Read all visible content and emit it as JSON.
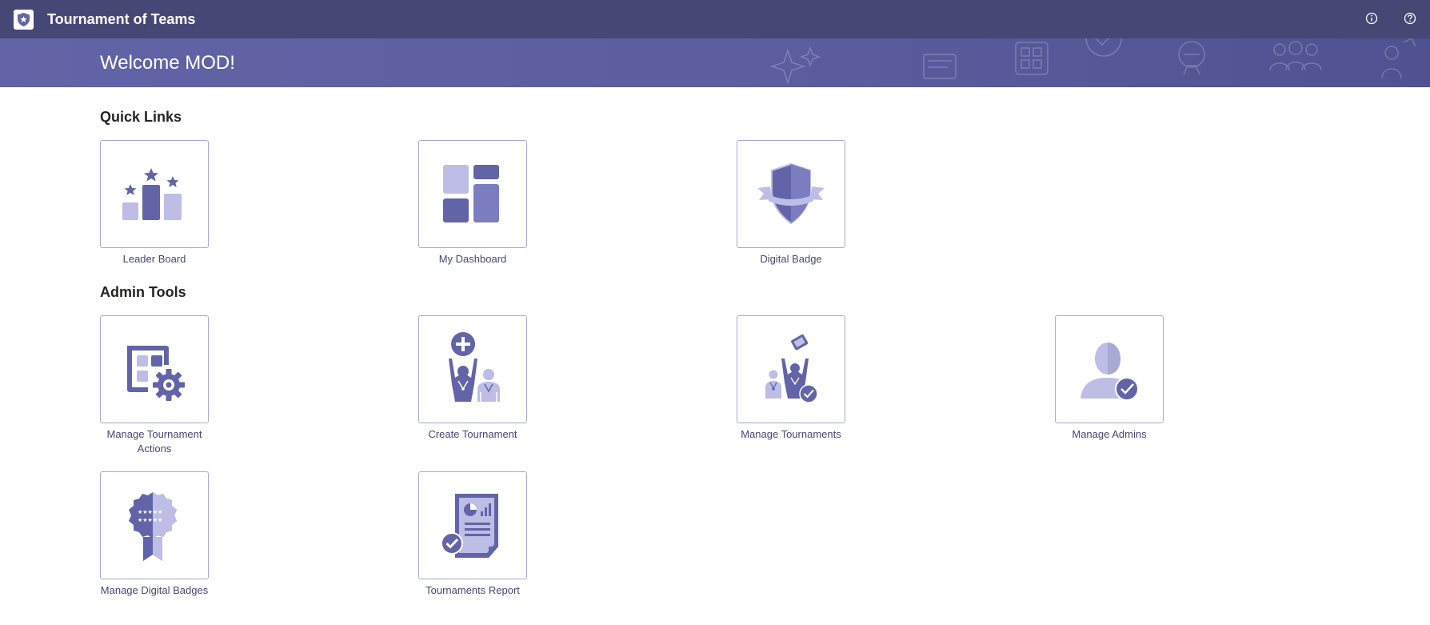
{
  "header": {
    "app_title": "Tournament of Teams",
    "logo_icon": "shield-star-logo",
    "info_icon": "info-circle-icon",
    "help_icon": "help-circle-icon"
  },
  "banner": {
    "welcome": "Welcome MOD!"
  },
  "quick_links": {
    "title": "Quick Links",
    "tiles": [
      {
        "label": "Leader Board",
        "icon": "leaderboard-podium-icon"
      },
      {
        "label": "My Dashboard",
        "icon": "dashboard-grid-icon"
      },
      {
        "label": "Digital Badge",
        "icon": "shield-badge-icon"
      }
    ]
  },
  "admin_tools": {
    "title": "Admin Tools",
    "tiles": [
      {
        "label": "Manage Tournament Actions",
        "icon": "grid-gear-icon"
      },
      {
        "label": "Create Tournament",
        "icon": "create-tournament-icon"
      },
      {
        "label": "Manage Tournaments",
        "icon": "manage-tournaments-icon"
      },
      {
        "label": "Manage Admins",
        "icon": "admin-check-icon"
      },
      {
        "label": "Manage Digital Badges",
        "icon": "rosette-badge-icon"
      },
      {
        "label": "Tournaments Report",
        "icon": "report-document-icon"
      }
    ]
  },
  "colors": {
    "topbar": "#464775",
    "banner": "#6264a7",
    "accent": "#6264a7",
    "light_accent": "#bdbde6",
    "tile_border": "#a8a9d4"
  }
}
